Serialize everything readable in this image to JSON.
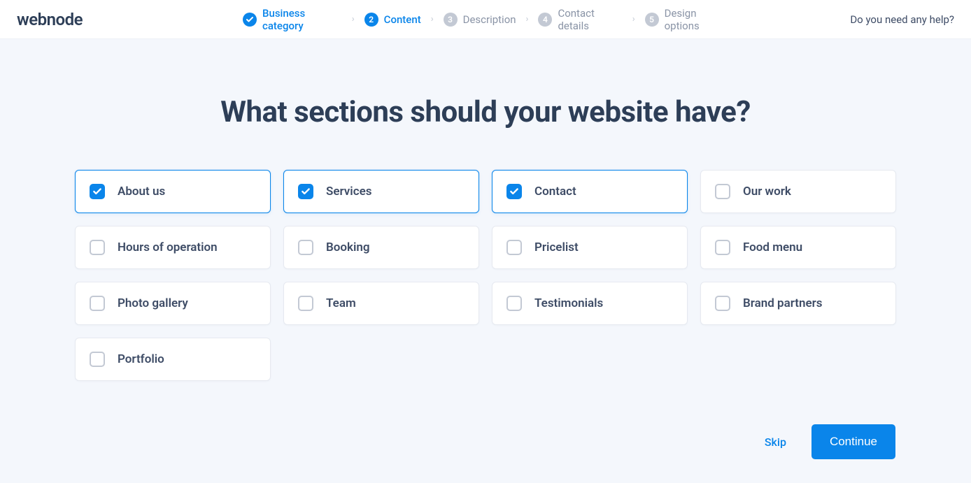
{
  "header": {
    "logo": "webnode",
    "help_label": "Do you need any help?",
    "steps": [
      {
        "label": "Business category",
        "state": "done"
      },
      {
        "label": "Content",
        "state": "active",
        "num": "2"
      },
      {
        "label": "Description",
        "state": "pending",
        "num": "3"
      },
      {
        "label": "Contact details",
        "state": "pending",
        "num": "4"
      },
      {
        "label": "Design options",
        "state": "pending",
        "num": "5"
      }
    ]
  },
  "main": {
    "title": "What sections should your website have?",
    "sections": [
      {
        "label": "About us",
        "selected": true
      },
      {
        "label": "Services",
        "selected": true
      },
      {
        "label": "Contact",
        "selected": true
      },
      {
        "label": "Our work",
        "selected": false
      },
      {
        "label": "Hours of operation",
        "selected": false
      },
      {
        "label": "Booking",
        "selected": false
      },
      {
        "label": "Pricelist",
        "selected": false
      },
      {
        "label": "Food menu",
        "selected": false
      },
      {
        "label": "Photo gallery",
        "selected": false
      },
      {
        "label": "Team",
        "selected": false
      },
      {
        "label": "Testimonials",
        "selected": false
      },
      {
        "label": "Brand partners",
        "selected": false
      },
      {
        "label": "Portfolio",
        "selected": false
      }
    ]
  },
  "footer": {
    "skip_label": "Skip",
    "continue_label": "Continue"
  }
}
